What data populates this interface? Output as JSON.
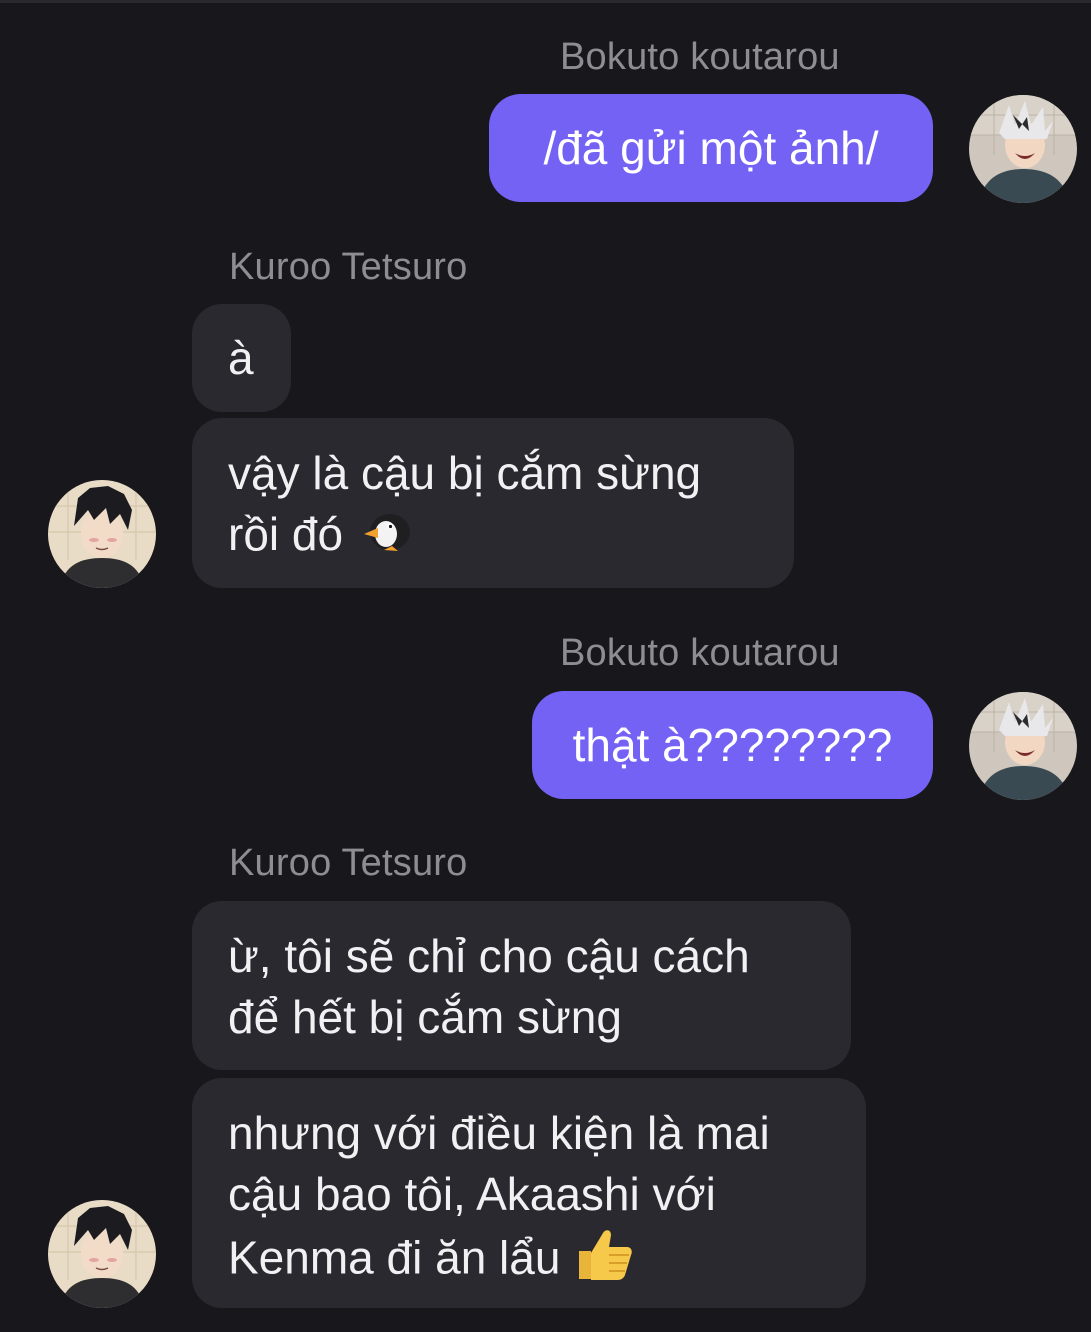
{
  "messages": [
    {
      "sender": "Bokuto koutarou",
      "direction": "out",
      "text": "/đã gửi một ảnh/"
    },
    {
      "sender": "Kuroo Tetsuro",
      "direction": "in",
      "text": "à"
    },
    {
      "sender": "Kuroo Tetsuro",
      "direction": "in",
      "text_line1": "vậy là cậu bị cắm sừng",
      "text_line2": "rồi đó",
      "emoji": "penguin-icon"
    },
    {
      "sender": "Bokuto koutarou",
      "direction": "out",
      "text": "thật à????????"
    },
    {
      "sender": "Kuroo Tetsuro",
      "direction": "in",
      "text_line1": "ừ, tôi sẽ chỉ cho cậu cách",
      "text_line2": "để hết bị cắm sừng"
    },
    {
      "sender": "Kuroo Tetsuro",
      "direction": "in",
      "text_line1": "nhưng với điều kiện là mai",
      "text_line2": "cậu bao tôi, Akaashi với",
      "text_line3": "Kenma đi ăn lẩu",
      "emoji": "thumbs-up-icon"
    }
  ],
  "colors": {
    "background": "#18171c",
    "outgoing_bubble": "#7462f5",
    "incoming_bubble": "#2a292f",
    "sender_name": "#8e8d93"
  }
}
